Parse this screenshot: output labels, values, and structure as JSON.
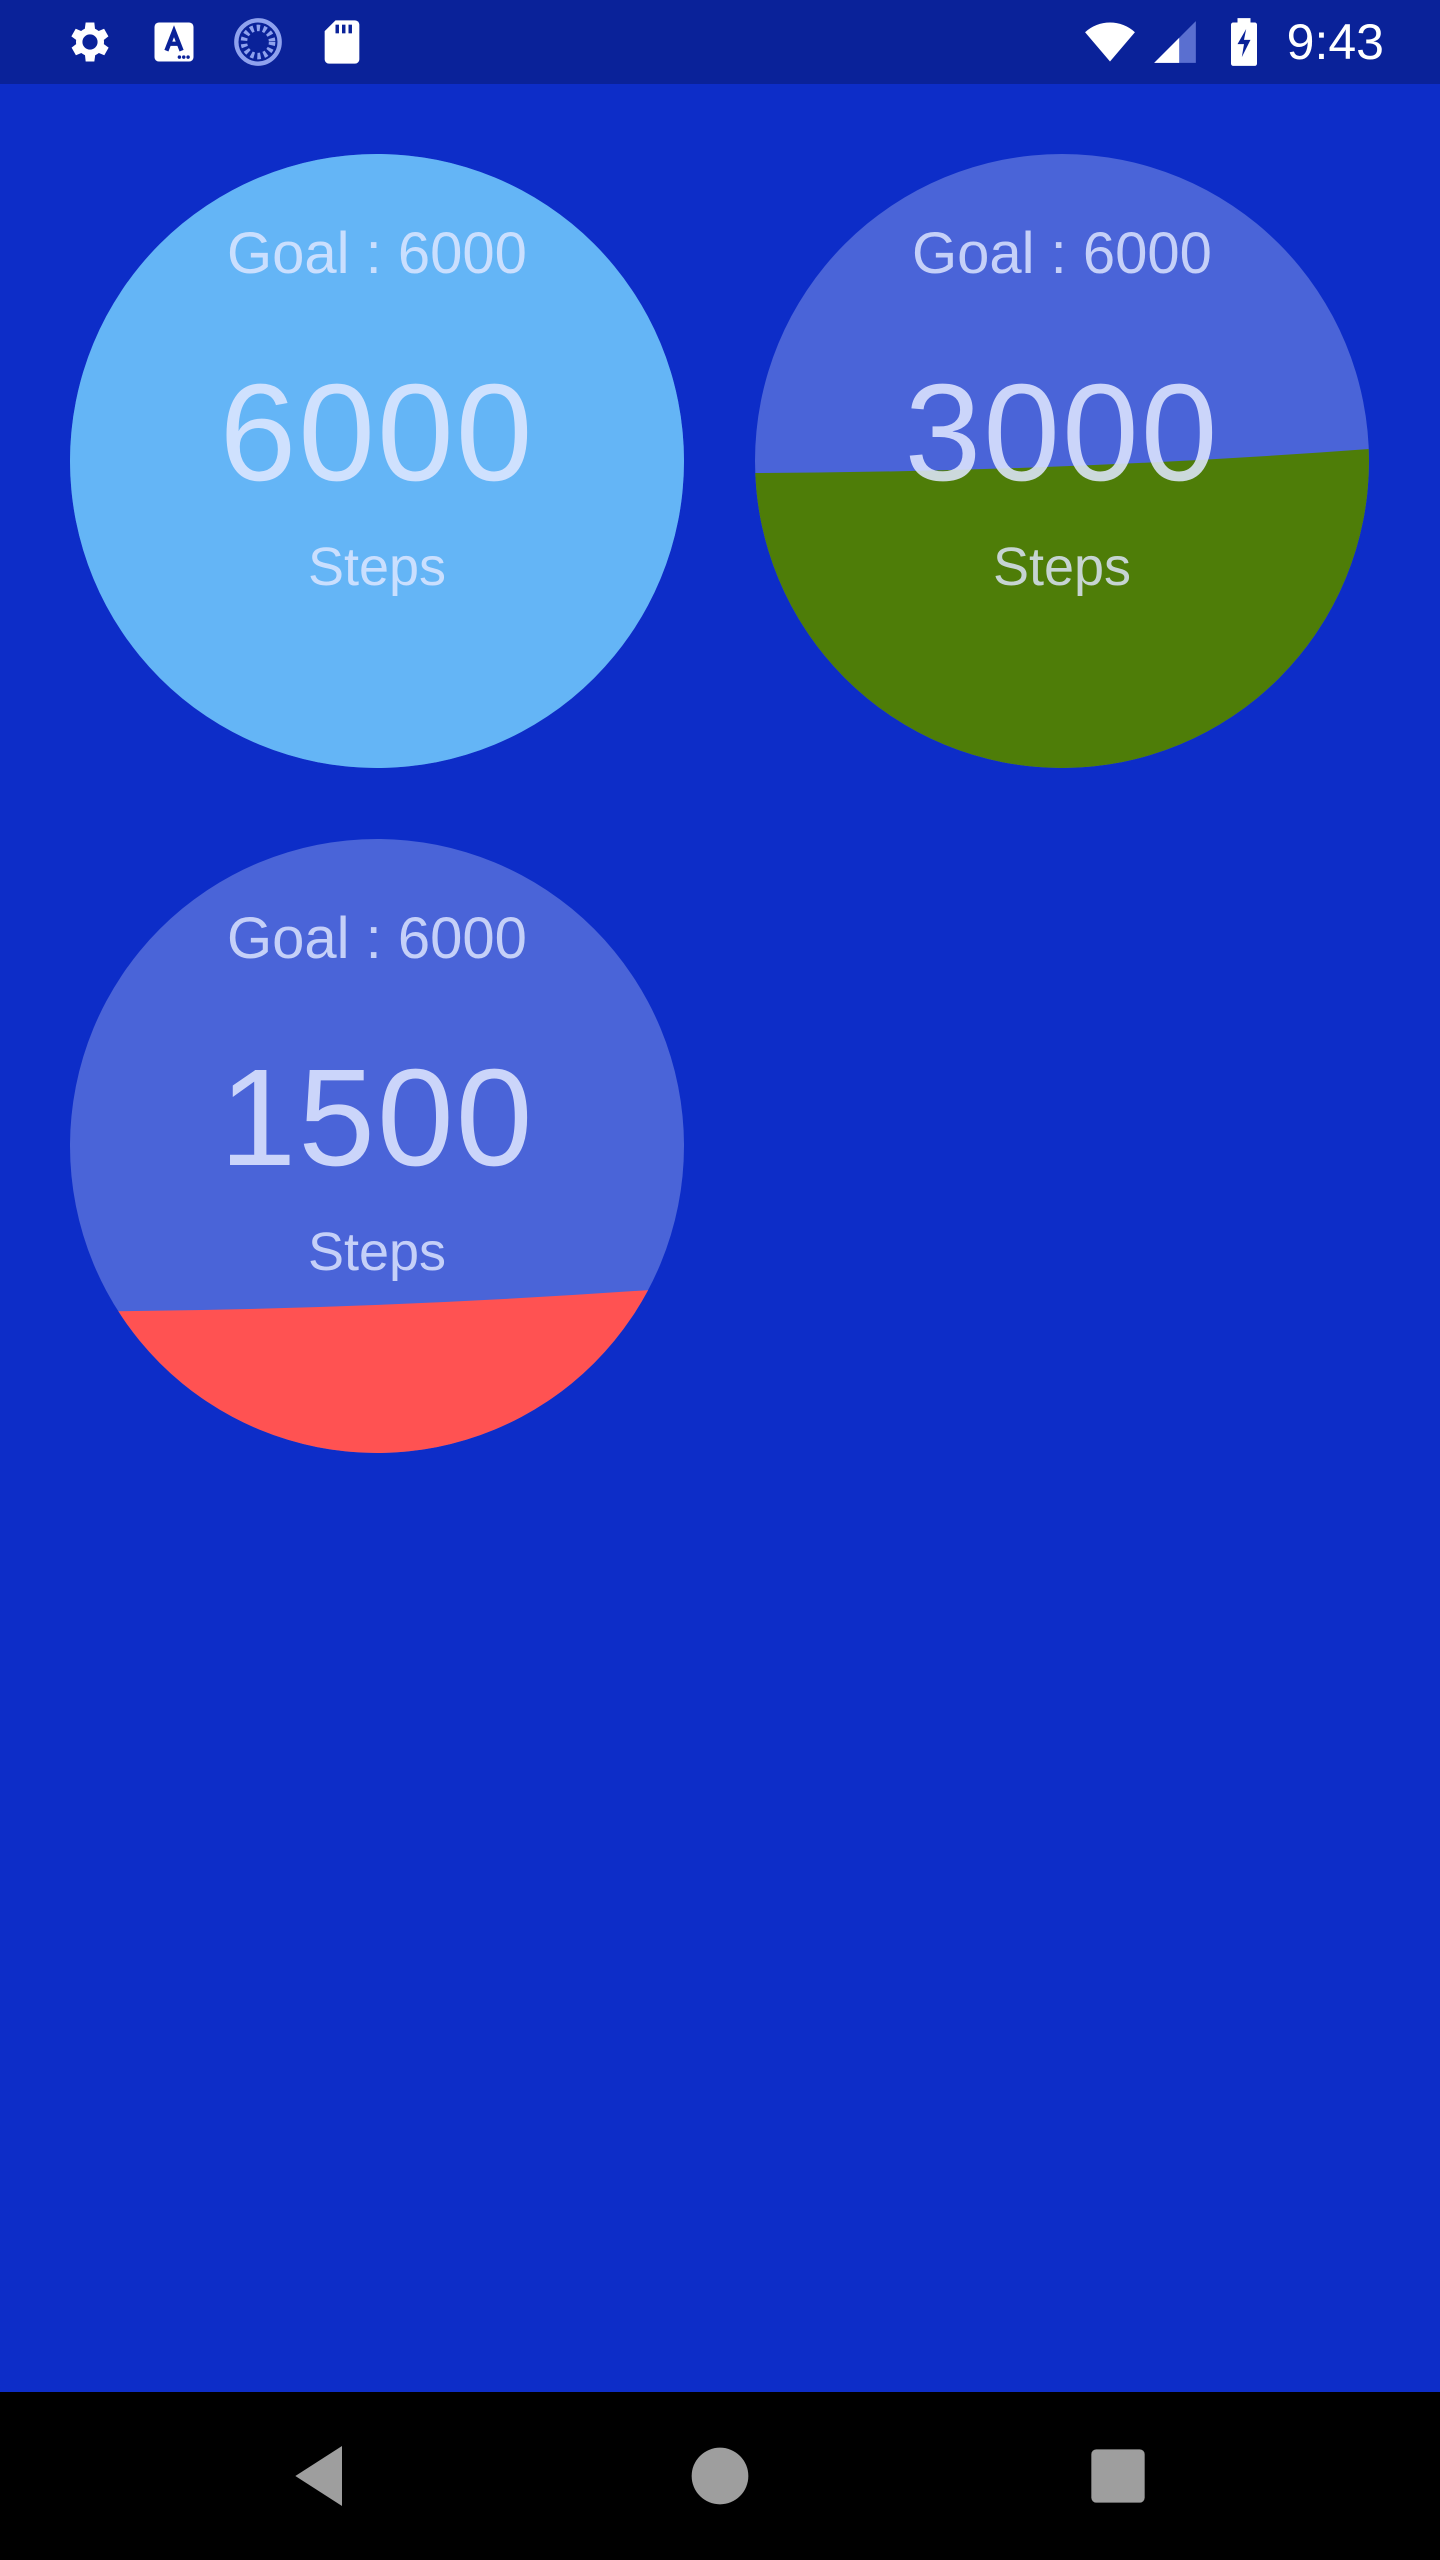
{
  "status_bar": {
    "time": "9:43",
    "left_icons": [
      "settings-icon",
      "text-a-icon",
      "sync-icon",
      "sd-card-icon"
    ],
    "right_icons": [
      "wifi-icon",
      "signal-icon",
      "battery-charging-icon"
    ]
  },
  "theme": {
    "background": "#0d2dc8",
    "status_bar": "#0a2299",
    "gauge_track": "#4a64d8"
  },
  "gauges": [
    {
      "goal_text": "Goal : 6000",
      "value_text": "6000",
      "unit_text": "Steps",
      "progress": 1.0,
      "fill_color": "#64b5f6"
    },
    {
      "goal_text": "Goal : 6000",
      "value_text": "3000",
      "unit_text": "Steps",
      "progress": 0.5,
      "fill_color": "#4e7d08"
    },
    {
      "goal_text": "Goal : 6000",
      "value_text": "1500",
      "unit_text": "Steps",
      "progress": 0.25,
      "fill_color": "#ff5252"
    }
  ],
  "nav_bar": {
    "buttons": [
      "back-icon",
      "home-icon",
      "recents-icon"
    ]
  }
}
